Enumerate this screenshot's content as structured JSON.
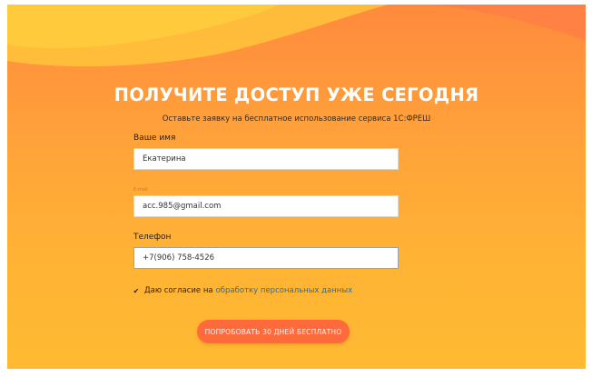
{
  "form": {
    "title": "ПОЛУЧИТЕ ДОСТУП УЖЕ СЕГОДНЯ",
    "subtitle": "Оставьте заявку на бесплатное использование сервиса 1С:ФРЕШ",
    "name_label": "Ваше имя",
    "name_value": "Екатерина",
    "email_label": "E-mail",
    "email_value": "acc.985@gmail.com",
    "phone_label": "Телефон",
    "phone_value": "+7(906) 758-4526",
    "consent_text": "Даю согласие на",
    "consent_link": "обработку персональных данных",
    "consent_checked": true,
    "submit_label": "ПОПРОБОВАТЬ 30 ДНЕЙ БЕСПЛАТНО"
  },
  "colors": {
    "background_top": "#ff8a3d",
    "background_bottom": "#ffba32",
    "button": "#ff6a3c",
    "link": "#1f6fb0"
  }
}
